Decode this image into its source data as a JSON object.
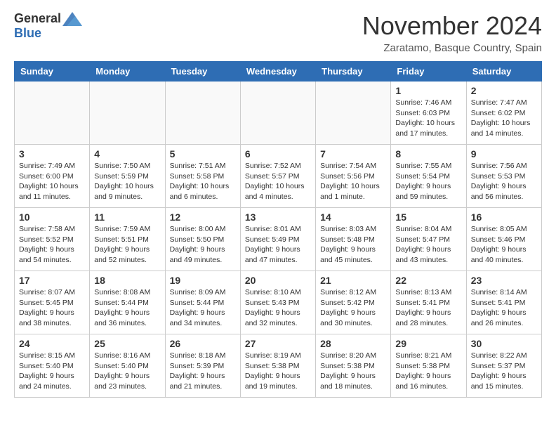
{
  "header": {
    "logo_general": "General",
    "logo_blue": "Blue",
    "month_title": "November 2024",
    "location": "Zaratamo, Basque Country, Spain"
  },
  "columns": [
    "Sunday",
    "Monday",
    "Tuesday",
    "Wednesday",
    "Thursday",
    "Friday",
    "Saturday"
  ],
  "weeks": [
    [
      {
        "day": "",
        "info": ""
      },
      {
        "day": "",
        "info": ""
      },
      {
        "day": "",
        "info": ""
      },
      {
        "day": "",
        "info": ""
      },
      {
        "day": "",
        "info": ""
      },
      {
        "day": "1",
        "info": "Sunrise: 7:46 AM\nSunset: 6:03 PM\nDaylight: 10 hours and 17 minutes."
      },
      {
        "day": "2",
        "info": "Sunrise: 7:47 AM\nSunset: 6:02 PM\nDaylight: 10 hours and 14 minutes."
      }
    ],
    [
      {
        "day": "3",
        "info": "Sunrise: 7:49 AM\nSunset: 6:00 PM\nDaylight: 10 hours and 11 minutes."
      },
      {
        "day": "4",
        "info": "Sunrise: 7:50 AM\nSunset: 5:59 PM\nDaylight: 10 hours and 9 minutes."
      },
      {
        "day": "5",
        "info": "Sunrise: 7:51 AM\nSunset: 5:58 PM\nDaylight: 10 hours and 6 minutes."
      },
      {
        "day": "6",
        "info": "Sunrise: 7:52 AM\nSunset: 5:57 PM\nDaylight: 10 hours and 4 minutes."
      },
      {
        "day": "7",
        "info": "Sunrise: 7:54 AM\nSunset: 5:56 PM\nDaylight: 10 hours and 1 minute."
      },
      {
        "day": "8",
        "info": "Sunrise: 7:55 AM\nSunset: 5:54 PM\nDaylight: 9 hours and 59 minutes."
      },
      {
        "day": "9",
        "info": "Sunrise: 7:56 AM\nSunset: 5:53 PM\nDaylight: 9 hours and 56 minutes."
      }
    ],
    [
      {
        "day": "10",
        "info": "Sunrise: 7:58 AM\nSunset: 5:52 PM\nDaylight: 9 hours and 54 minutes."
      },
      {
        "day": "11",
        "info": "Sunrise: 7:59 AM\nSunset: 5:51 PM\nDaylight: 9 hours and 52 minutes."
      },
      {
        "day": "12",
        "info": "Sunrise: 8:00 AM\nSunset: 5:50 PM\nDaylight: 9 hours and 49 minutes."
      },
      {
        "day": "13",
        "info": "Sunrise: 8:01 AM\nSunset: 5:49 PM\nDaylight: 9 hours and 47 minutes."
      },
      {
        "day": "14",
        "info": "Sunrise: 8:03 AM\nSunset: 5:48 PM\nDaylight: 9 hours and 45 minutes."
      },
      {
        "day": "15",
        "info": "Sunrise: 8:04 AM\nSunset: 5:47 PM\nDaylight: 9 hours and 43 minutes."
      },
      {
        "day": "16",
        "info": "Sunrise: 8:05 AM\nSunset: 5:46 PM\nDaylight: 9 hours and 40 minutes."
      }
    ],
    [
      {
        "day": "17",
        "info": "Sunrise: 8:07 AM\nSunset: 5:45 PM\nDaylight: 9 hours and 38 minutes."
      },
      {
        "day": "18",
        "info": "Sunrise: 8:08 AM\nSunset: 5:44 PM\nDaylight: 9 hours and 36 minutes."
      },
      {
        "day": "19",
        "info": "Sunrise: 8:09 AM\nSunset: 5:44 PM\nDaylight: 9 hours and 34 minutes."
      },
      {
        "day": "20",
        "info": "Sunrise: 8:10 AM\nSunset: 5:43 PM\nDaylight: 9 hours and 32 minutes."
      },
      {
        "day": "21",
        "info": "Sunrise: 8:12 AM\nSunset: 5:42 PM\nDaylight: 9 hours and 30 minutes."
      },
      {
        "day": "22",
        "info": "Sunrise: 8:13 AM\nSunset: 5:41 PM\nDaylight: 9 hours and 28 minutes."
      },
      {
        "day": "23",
        "info": "Sunrise: 8:14 AM\nSunset: 5:41 PM\nDaylight: 9 hours and 26 minutes."
      }
    ],
    [
      {
        "day": "24",
        "info": "Sunrise: 8:15 AM\nSunset: 5:40 PM\nDaylight: 9 hours and 24 minutes."
      },
      {
        "day": "25",
        "info": "Sunrise: 8:16 AM\nSunset: 5:40 PM\nDaylight: 9 hours and 23 minutes."
      },
      {
        "day": "26",
        "info": "Sunrise: 8:18 AM\nSunset: 5:39 PM\nDaylight: 9 hours and 21 minutes."
      },
      {
        "day": "27",
        "info": "Sunrise: 8:19 AM\nSunset: 5:38 PM\nDaylight: 9 hours and 19 minutes."
      },
      {
        "day": "28",
        "info": "Sunrise: 8:20 AM\nSunset: 5:38 PM\nDaylight: 9 hours and 18 minutes."
      },
      {
        "day": "29",
        "info": "Sunrise: 8:21 AM\nSunset: 5:38 PM\nDaylight: 9 hours and 16 minutes."
      },
      {
        "day": "30",
        "info": "Sunrise: 8:22 AM\nSunset: 5:37 PM\nDaylight: 9 hours and 15 minutes."
      }
    ]
  ]
}
